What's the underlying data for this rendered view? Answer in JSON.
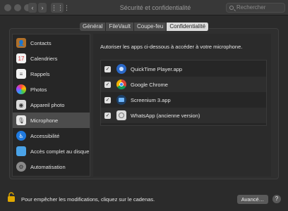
{
  "window": {
    "title": "Sécurité et confidentialité",
    "search_placeholder": "Rechercher"
  },
  "tabs": [
    {
      "label": "Général"
    },
    {
      "label": "FileVault"
    },
    {
      "label": "Coupe-feu"
    },
    {
      "label": "Confidentialité"
    }
  ],
  "sidebar": {
    "items": [
      {
        "label": "Contacts",
        "icon": "contacts-icon"
      },
      {
        "label": "Calendriers",
        "icon": "calendar-icon"
      },
      {
        "label": "Rappels",
        "icon": "reminders-icon"
      },
      {
        "label": "Photos",
        "icon": "photos-icon"
      },
      {
        "label": "Appareil photo",
        "icon": "camera-icon"
      },
      {
        "label": "Microphone",
        "icon": "microphone-icon"
      },
      {
        "label": "Accessibilité",
        "icon": "accessibility-icon"
      },
      {
        "label": "Accès complet au disque",
        "icon": "folder-icon"
      },
      {
        "label": "Automatisation",
        "icon": "gear-icon"
      }
    ],
    "selected": "Microphone"
  },
  "main": {
    "prompt": "Autoriser les apps ci-dessous à accéder à votre microphone.",
    "apps": [
      {
        "name": "QuickTime Player.app",
        "checked": true
      },
      {
        "name": "Google Chrome",
        "checked": true
      },
      {
        "name": "Screenium 3.app",
        "checked": true
      },
      {
        "name": "WhatsApp (ancienne version)",
        "checked": true
      }
    ]
  },
  "footer": {
    "lock_text": "Pour empêcher les modifications, cliquez sur le cadenas.",
    "advanced_label": "Avancé…",
    "help_label": "?"
  },
  "colors": {
    "background": "#2b2b2b",
    "selected_row": "#4c4c4c",
    "lock_accent": "#e0a800"
  }
}
